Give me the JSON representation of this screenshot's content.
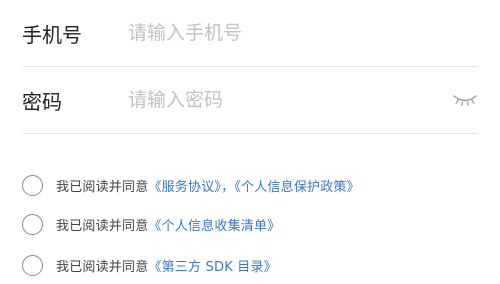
{
  "form": {
    "phone": {
      "label": "手机号",
      "placeholder": "请输入手机号",
      "value": ""
    },
    "password": {
      "label": "密码",
      "placeholder": "请输入密码",
      "value": "",
      "toggle_icon": "eye-closed-icon"
    }
  },
  "agreements": [
    {
      "checked": false,
      "prefix": "我已阅读并同意",
      "links": [
        "《服务协议》",
        "《个人信息保护政策》"
      ],
      "separator": "，"
    },
    {
      "checked": false,
      "prefix": "我已阅读并同意",
      "links": [
        "《个人信息收集清单》"
      ]
    },
    {
      "checked": false,
      "prefix": "我已阅读并同意",
      "links": [
        "《第三方 SDK 目录》"
      ]
    }
  ],
  "colors": {
    "link": "#3a77c7",
    "placeholder": "#c2c2c2",
    "divider": "#e6e6e6",
    "radio_border": "#8a8a8a"
  }
}
